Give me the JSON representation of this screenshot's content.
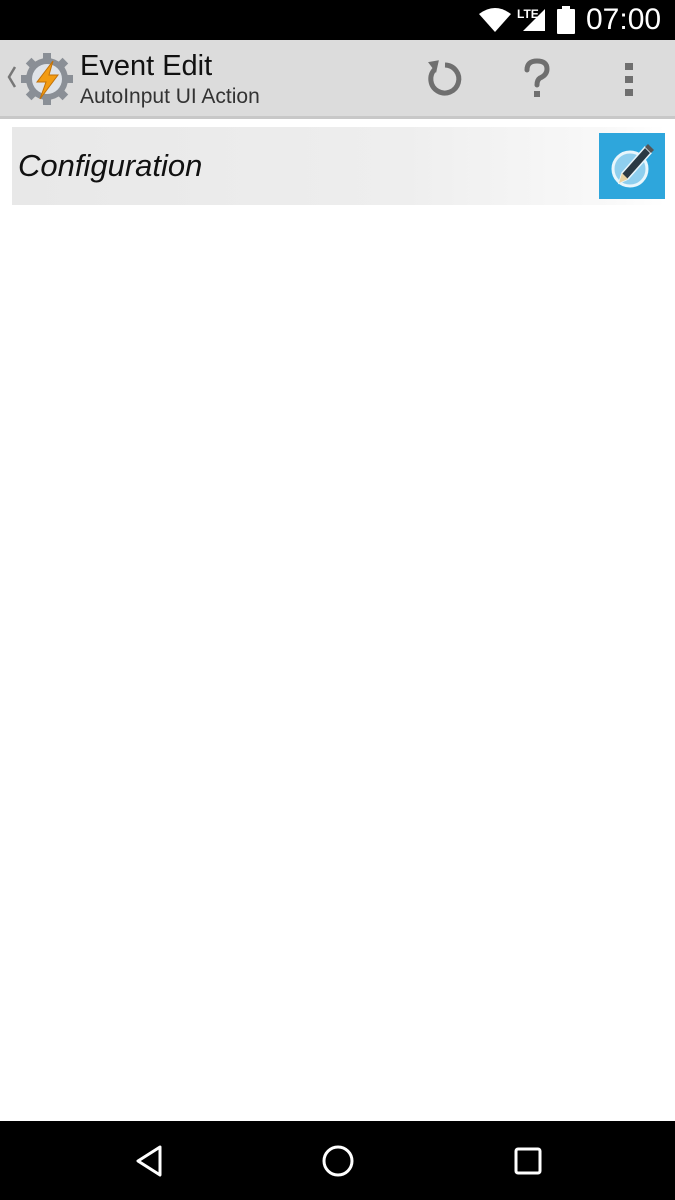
{
  "status_bar": {
    "network_label": "LTE",
    "time": "07:00",
    "icons": [
      "wifi-icon",
      "signal-icon",
      "battery-icon"
    ]
  },
  "action_bar": {
    "title": "Event Edit",
    "subtitle": "AutoInput UI Action",
    "app_icon": "tasker-gear-lightning-icon",
    "actions": [
      "refresh-icon",
      "help-icon",
      "overflow-menu-icon"
    ]
  },
  "content": {
    "config_label": "Configuration",
    "config_icon": "pencil-edit-icon",
    "config_icon_color": "#2ea6dc"
  },
  "nav_bar": {
    "icons": [
      "back-icon",
      "home-icon",
      "recents-icon"
    ]
  }
}
